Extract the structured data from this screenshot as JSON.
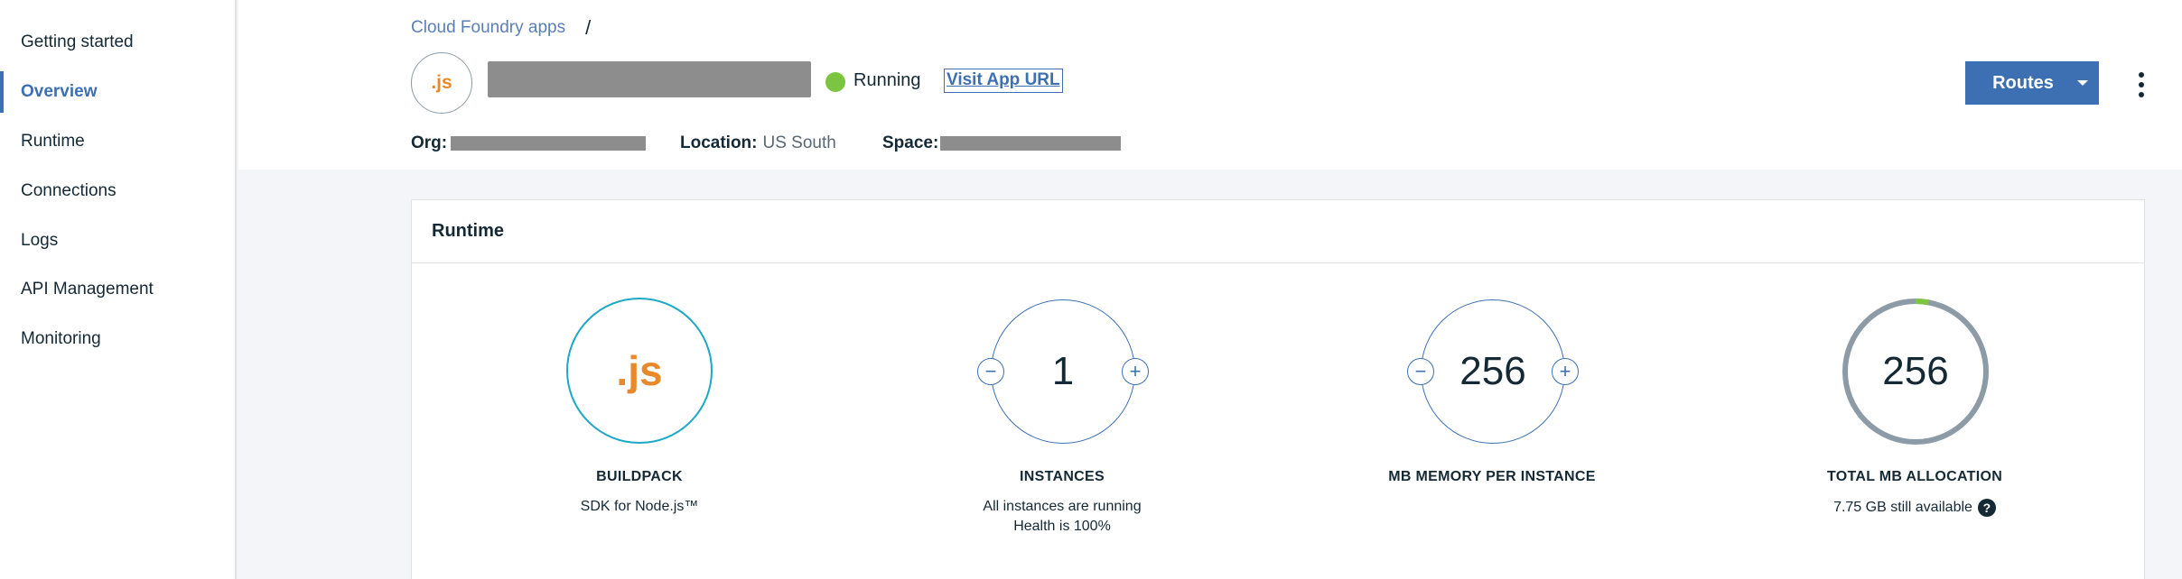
{
  "sidebar": {
    "items": [
      {
        "label": "Getting started",
        "active": false
      },
      {
        "label": "Overview",
        "active": true
      },
      {
        "label": "Runtime",
        "active": false
      },
      {
        "label": "Connections",
        "active": false
      },
      {
        "label": "Logs",
        "active": false
      },
      {
        "label": "API Management",
        "active": false
      },
      {
        "label": "Monitoring",
        "active": false
      }
    ]
  },
  "header": {
    "breadcrumb": {
      "link": "Cloud Foundry apps",
      "separator": "/"
    },
    "app_icon_text": ".js",
    "status": {
      "text": "Running",
      "color": "#7cc540"
    },
    "visit_url_label": "Visit App URL",
    "routes_label": "Routes",
    "meta": {
      "org_label": "Org:",
      "location_label": "Location:",
      "location_value": "US South",
      "space_label": "Space:"
    }
  },
  "runtime": {
    "title": "Runtime",
    "buildpack": {
      "icon_text": ".js",
      "title": "BUILDPACK",
      "subtitle": "SDK for Node.js™"
    },
    "instances": {
      "value": "1",
      "title": "INSTANCES",
      "line1": "All instances are running",
      "line2": "Health is 100%"
    },
    "memory": {
      "value": "256",
      "title": "MB MEMORY PER INSTANCE"
    },
    "total": {
      "value": "256",
      "title": "TOTAL MB ALLOCATION",
      "subtitle": "7.75 GB still available",
      "used_fraction": 0.03
    }
  },
  "colors": {
    "accent": "#3d70b2",
    "running": "#7cc540",
    "nodejs": "#e8892b",
    "buildpack_ring": "#1ba8c9"
  }
}
